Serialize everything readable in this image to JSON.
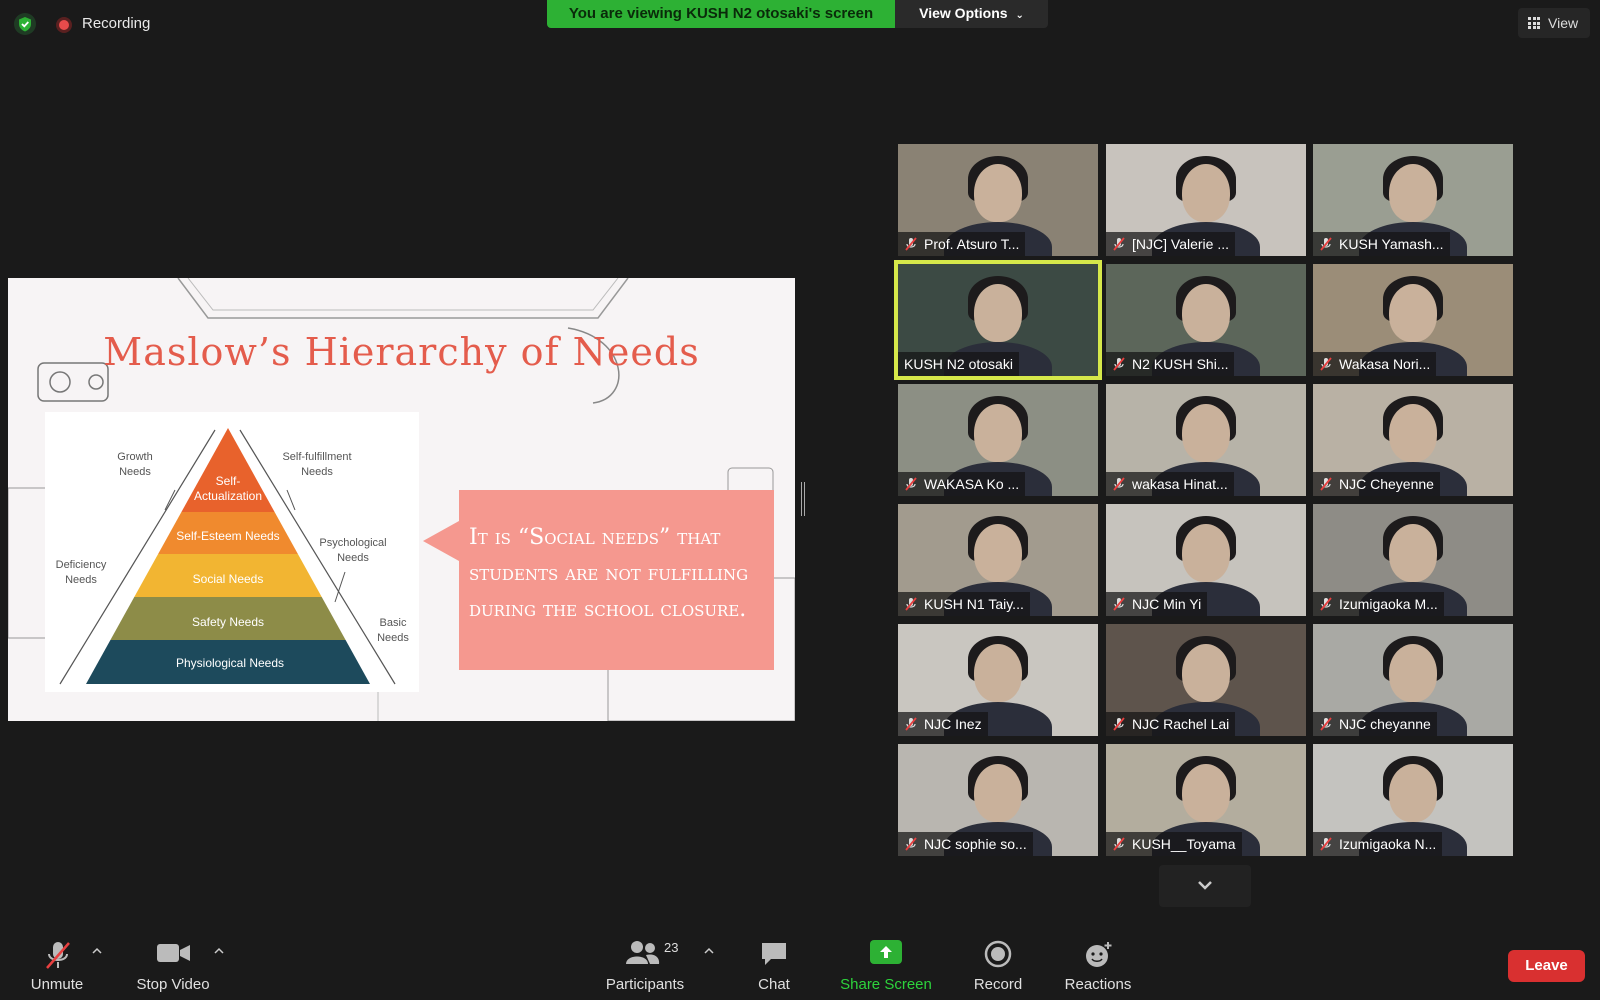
{
  "topbar": {
    "recording_label": "Recording",
    "banner_text": "You are viewing KUSH  N2   otosaki's screen",
    "view_options_label": "View Options",
    "view_label": "View"
  },
  "slide": {
    "title": "Maslow’s Hierarchy of Needs",
    "pyramid_levels": [
      "Self-Actualization",
      "Self-Esteem Needs",
      "Social Needs",
      "Safety Needs",
      "Physiological Needs"
    ],
    "pyramid_level_colors": [
      "#e8622c",
      "#f08a2e",
      "#f2b532",
      "#8d8c48",
      "#1d4a5c"
    ],
    "pyramid_side_labels": {
      "growth": "Growth Needs",
      "self_fulfillment": "Self-fulfillment Needs",
      "psychological": "Psychological Needs",
      "deficiency": "Deficiency Needs",
      "basic": "Basic Needs"
    },
    "quote": "It is “Social needs” that students are not fulfilling during the school closure."
  },
  "participants": [
    {
      "name": "Prof. Atsuro T...",
      "bg": "#8a8274"
    },
    {
      "name": "[NJC] Valerie ...",
      "bg": "#c8c3bd"
    },
    {
      "name": "KUSH Yamash...",
      "bg": "#9a9e92"
    },
    {
      "name": "KUSH  N2   otosaki",
      "bg": "#3c4a44",
      "active": true
    },
    {
      "name": "N2 KUSH  Shi...",
      "bg": "#5c665a"
    },
    {
      "name": "Wakasa   Nori...",
      "bg": "#9b8d78"
    },
    {
      "name": "WAKASA   Ko ...",
      "bg": "#8c8f84"
    },
    {
      "name": "wakasa Hinat...",
      "bg": "#b7b3a8"
    },
    {
      "name": "NJC Cheyenne",
      "bg": "#b9b1a4"
    },
    {
      "name": "KUSH N1 Taiy...",
      "bg": "#a29b8e"
    },
    {
      "name": "NJC Min Yi",
      "bg": "#c6c3bd"
    },
    {
      "name": "Izumigaoka M...",
      "bg": "#8e8c86"
    },
    {
      "name": "NJC Inez",
      "bg": "#c9c6c0"
    },
    {
      "name": "NJC Rachel Lai",
      "bg": "#5e544c"
    },
    {
      "name": "NJC cheyanne",
      "bg": "#a9a9a4"
    },
    {
      "name": "NJC sophie so...",
      "bg": "#b9b6b0"
    },
    {
      "name": "KUSH__Toyama",
      "bg": "#b3ad9e"
    },
    {
      "name": "Izumigaoka N...",
      "bg": "#c4c3bf"
    }
  ],
  "toolbar": {
    "unmute_label": "Unmute",
    "stop_video_label": "Stop Video",
    "participants_label": "Participants",
    "participants_count": "23",
    "chat_label": "Chat",
    "share_screen_label": "Share Screen",
    "record_label": "Record",
    "reactions_label": "Reactions",
    "leave_label": "Leave"
  },
  "colors": {
    "banner_green": "#2db134",
    "active_speaker": "#d6e84a",
    "leave_red": "#d93030",
    "quote_pink": "#f5988f",
    "title_red": "#e45c4c"
  }
}
